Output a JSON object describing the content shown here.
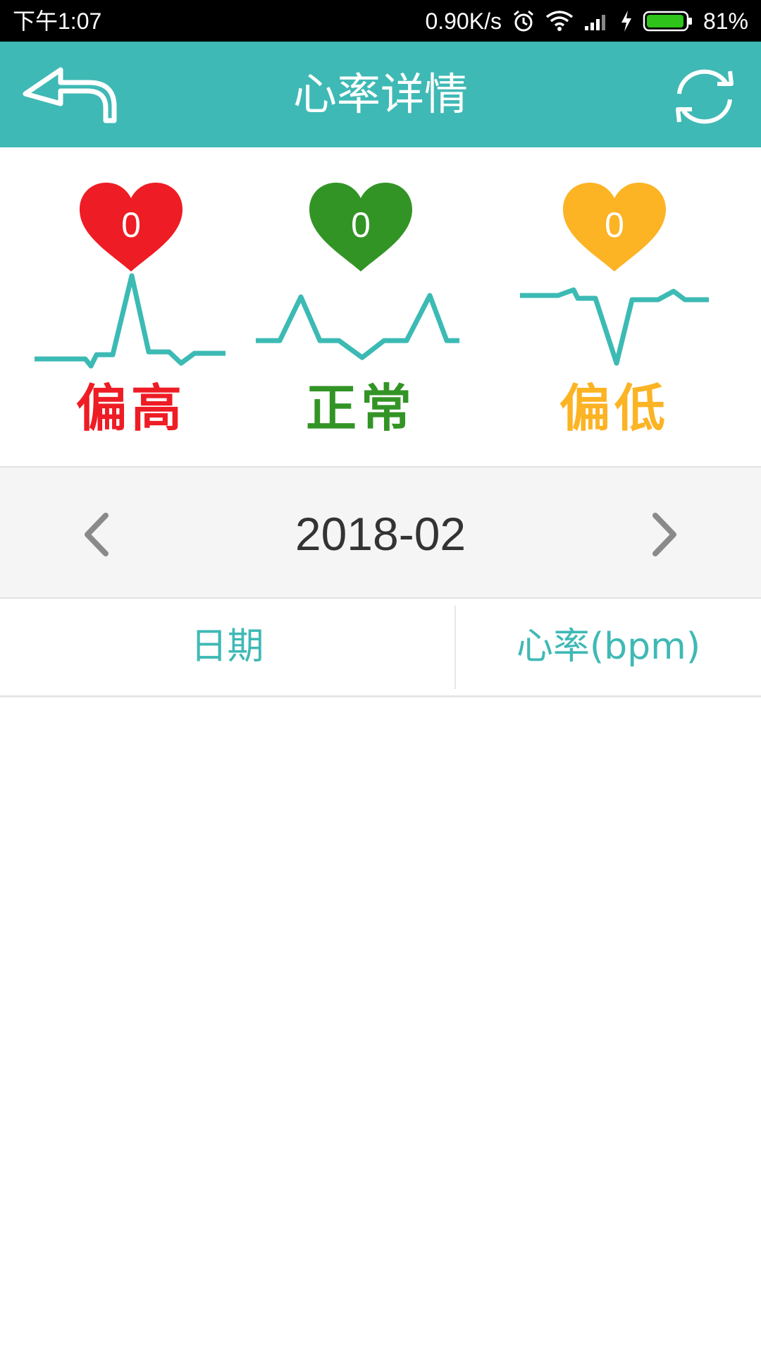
{
  "status_bar": {
    "time": "下午1:07",
    "net_speed": "0.90K/s",
    "battery": "81%",
    "icons": [
      "alarm-icon",
      "wifi-icon",
      "signal-icon",
      "charging-icon",
      "battery-icon"
    ]
  },
  "app_bar": {
    "title": "心率详情",
    "back_icon": "back-arrow-icon",
    "refresh_icon": "refresh-icon",
    "background": "#3fb9b5"
  },
  "summary": [
    {
      "key": "high",
      "count": "0",
      "label": "偏高",
      "color": "#ee1c24"
    },
    {
      "key": "normal",
      "count": "0",
      "label": "正常",
      "color": "#339426"
    },
    {
      "key": "low",
      "count": "0",
      "label": "偏低",
      "color": "#fcb324"
    }
  ],
  "month_bar": {
    "month": "2018-02",
    "prev_icon": "chevron-left-icon",
    "next_icon": "chevron-right-icon"
  },
  "table": {
    "columns": [
      "日期",
      "心率(bpm)"
    ],
    "rows": []
  },
  "colors": {
    "accent": "#3fb9b5",
    "wave": "#3cbab4",
    "month_text": "#333333"
  }
}
